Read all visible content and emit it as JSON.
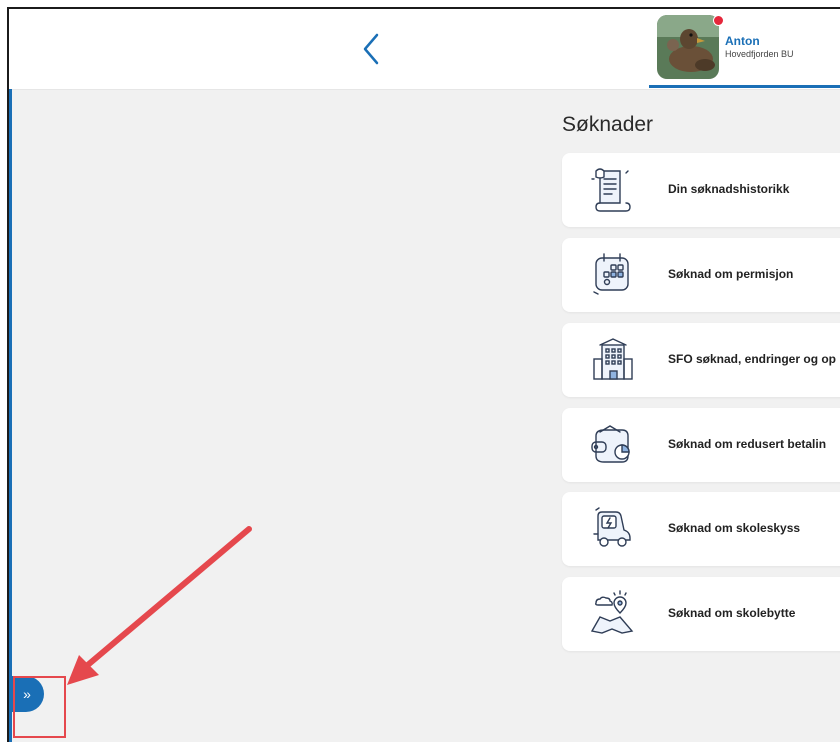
{
  "profile": {
    "name": "Anton",
    "school": "Hovedfjorden BU"
  },
  "page": {
    "title": "Søknader"
  },
  "cards": [
    {
      "label": "Din søknadshistorikk",
      "icon": "scroll-icon"
    },
    {
      "label": "Søknad om permisjon",
      "icon": "calendar-icon"
    },
    {
      "label": "SFO søknad, endringer og op",
      "icon": "building-icon"
    },
    {
      "label": "Søknad om redusert betalin",
      "icon": "wallet-icon"
    },
    {
      "label": "Søknad om skoleskyss",
      "icon": "car-icon"
    },
    {
      "label": "Søknad om skolebytte",
      "icon": "map-pin-icon"
    }
  ],
  "sidebar_toggle": {
    "label": "»"
  },
  "colors": {
    "accent": "#1a6fb6",
    "notification": "#e5273b",
    "annotation": "#e5484d",
    "background": "#f1f1f1"
  }
}
